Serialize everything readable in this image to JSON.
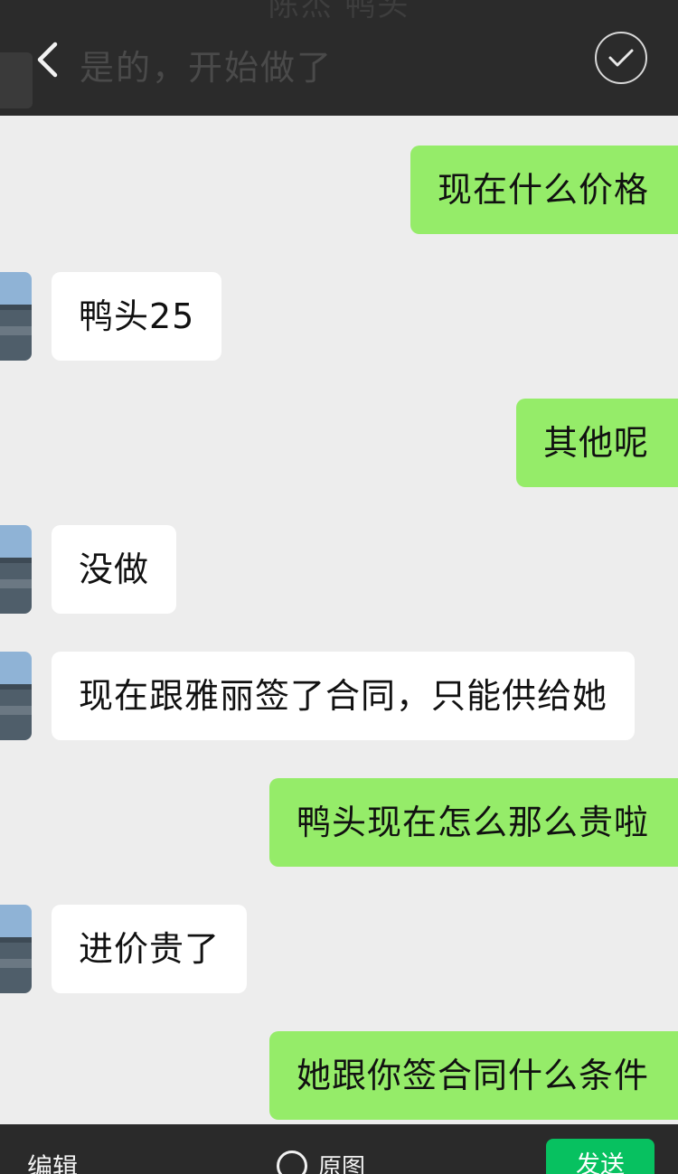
{
  "header": {
    "ghost_title": "陈杰 鸭头",
    "ghost_message": "是的，开始做了",
    "back_icon": "chevron-left-icon",
    "confirm_icon": "check-circle-icon"
  },
  "messages": [
    {
      "side": "out",
      "text": "现在什么价格"
    },
    {
      "side": "in",
      "text": "鸭头25"
    },
    {
      "side": "out",
      "text": "其他呢"
    },
    {
      "side": "in",
      "text": "没做"
    },
    {
      "side": "in",
      "text": "现在跟雅丽签了合同，只能供给她"
    },
    {
      "side": "out",
      "text": "鸭头现在怎么那么贵啦"
    },
    {
      "side": "in",
      "text": "进价贵了"
    },
    {
      "side": "out",
      "text": "她跟你签合同什么条件"
    }
  ],
  "footer": {
    "edit_label": "编辑",
    "original_label": "原图",
    "send_label": "发送"
  },
  "colors": {
    "outgoing_bubble": "#95ec69",
    "incoming_bubble": "#ffffff",
    "send_button": "#07c160",
    "background": "#ededed"
  }
}
